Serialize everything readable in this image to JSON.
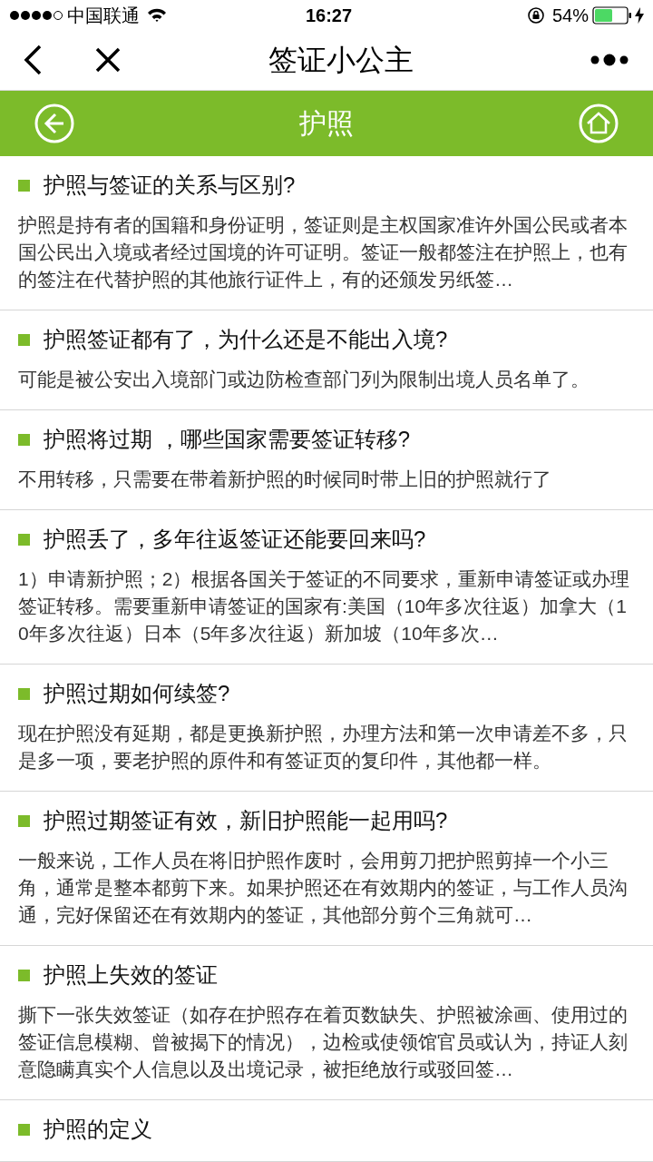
{
  "status_bar": {
    "carrier": "中国联通",
    "time": "16:27",
    "battery": "54%"
  },
  "nav": {
    "title": "签证小公主"
  },
  "header": {
    "title": "护照"
  },
  "items": [
    {
      "title": "护照与签证的关系与区别?",
      "body": "护照是持有者的国籍和身份证明，签证则是主权国家准许外国公民或者本国公民出入境或者经过国境的许可证明。签证一般都签注在护照上，也有的签注在代替护照的其他旅行证件上，有的还颁发另纸签…"
    },
    {
      "title": "护照签证都有了，为什么还是不能出入境?",
      "body": "可能是被公安出入境部门或边防检查部门列为限制出境人员名单了。"
    },
    {
      "title": "护照将过期 ，哪些国家需要签证转移?",
      "body": "不用转移，只需要在带着新护照的时候同时带上旧的护照就行了"
    },
    {
      "title": "护照丢了，多年往返签证还能要回来吗?",
      "body": "1）申请新护照；2）根据各国关于签证的不同要求，重新申请签证或办理签证转移。需要重新申请签证的国家有:美国（10年多次往返）加拿大（10年多次往返）日本（5年多次往返）新加坡（10年多次…"
    },
    {
      "title": "护照过期如何续签?",
      "body": "现在护照没有延期，都是更换新护照，办理方法和第一次申请差不多，只是多一项，要老护照的原件和有签证页的复印件，其他都一样。"
    },
    {
      "title": "护照过期签证有效，新旧护照能一起用吗?",
      "body": "一般来说，工作人员在将旧护照作废时，会用剪刀把护照剪掉一个小三角，通常是整本都剪下来。如果护照还在有效期内的签证，与工作人员沟通，完好保留还在有效期内的签证，其他部分剪个三角就可…"
    },
    {
      "title": "护照上失效的签证",
      "body": "撕下一张失效签证（如存在护照存在着页数缺失、护照被涂画、使用过的签证信息模糊、曾被揭下的情况），边检或使领馆官员或认为，持证人刻意隐瞒真实个人信息以及出境记录，被拒绝放行或驳回签…"
    },
    {
      "title": "护照的定义"
    }
  ]
}
